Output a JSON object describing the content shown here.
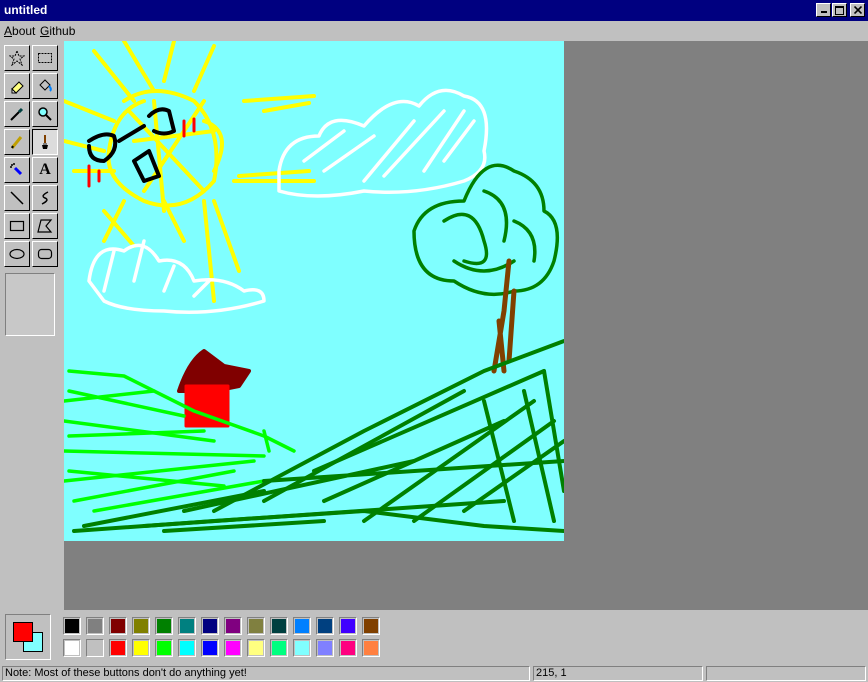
{
  "window": {
    "title": "untitled",
    "minimize_icon": "minimize-icon",
    "maximize_icon": "maximize-icon",
    "close_icon": "close-icon"
  },
  "menu": {
    "items": [
      {
        "label": "About",
        "accel": "A",
        "rest": "bout"
      },
      {
        "label": "Github",
        "accel": "G",
        "rest": "ithub"
      }
    ]
  },
  "tools": [
    {
      "name": "free-form-select",
      "icon": "star-select-icon",
      "pressed": false
    },
    {
      "name": "select",
      "icon": "rect-select-icon",
      "pressed": false
    },
    {
      "name": "eraser",
      "icon": "eraser-icon",
      "pressed": false
    },
    {
      "name": "fill-with-color",
      "icon": "paint-bucket-icon",
      "pressed": false
    },
    {
      "name": "pick-color",
      "icon": "eyedropper-icon",
      "pressed": false
    },
    {
      "name": "magnifier",
      "icon": "magnifier-icon",
      "pressed": false
    },
    {
      "name": "pencil",
      "icon": "pencil-icon",
      "pressed": false
    },
    {
      "name": "brush",
      "icon": "brush-icon",
      "pressed": true
    },
    {
      "name": "airbrush",
      "icon": "airbrush-icon",
      "pressed": false
    },
    {
      "name": "text",
      "icon": "text-icon",
      "pressed": false
    },
    {
      "name": "line",
      "icon": "line-icon",
      "pressed": false
    },
    {
      "name": "curve",
      "icon": "curve-icon",
      "pressed": false
    },
    {
      "name": "rectangle",
      "icon": "rectangle-icon",
      "pressed": false
    },
    {
      "name": "polygon",
      "icon": "polygon-icon",
      "pressed": false
    },
    {
      "name": "ellipse",
      "icon": "ellipse-icon",
      "pressed": false
    },
    {
      "name": "rounded-rectangle",
      "icon": "rounded-rectangle-icon",
      "pressed": false
    }
  ],
  "text_tool_glyph": "A",
  "colors": {
    "primary": "#ff0000",
    "secondary": "#80ffff",
    "canvas_bg": "#7fffff"
  },
  "palette": [
    "#000000",
    "#808080",
    "#800000",
    "#808000",
    "#008000",
    "#008080",
    "#000080",
    "#800080",
    "#808040",
    "#004040",
    "#0080ff",
    "#004080",
    "#4000ff",
    "#804000",
    "#ffffff",
    "#c0c0c0",
    "#ff0000",
    "#ffff00",
    "#00ff00",
    "#00ffff",
    "#0000ff",
    "#ff00ff",
    "#ffff80",
    "#00ff80",
    "#80ffff",
    "#8080ff",
    "#ff0080",
    "#ff8040"
  ],
  "status": {
    "note": "Note: Most of these buttons don't do anything yet!",
    "coords": "215, 1",
    "extra": ""
  }
}
